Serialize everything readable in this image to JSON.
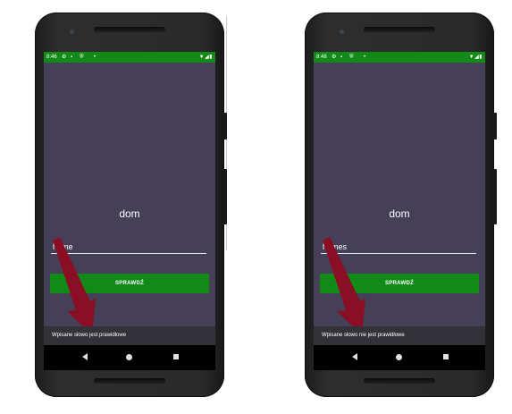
{
  "colors": {
    "screen_bg": "#453f57",
    "accent_green": "#118a17",
    "arrow_red": "#8a0f24",
    "snackbar_bg": "#333238",
    "nav_bar_bg": "#000000"
  },
  "icons": {
    "status": [
      "gear-icon",
      "sim-card-icon",
      "shield-icon",
      "notification-dot-icon",
      "wifi-icon",
      "signal-icon",
      "battery-icon"
    ],
    "nav": [
      "back-icon",
      "home-icon",
      "recents-icon"
    ],
    "annotation": "arrow-icon"
  },
  "left_phone": {
    "status": {
      "time": "8:46"
    },
    "word": "dom",
    "input_value": "home",
    "button_label": "SPRAWDŹ",
    "snackbar_text": "Wpisane słowo jest prawidłowe"
  },
  "right_phone": {
    "status": {
      "time": "8:48"
    },
    "word": "dom",
    "input_value": "homes",
    "button_label": "SPRAWDŹ",
    "snackbar_text": "Wpisane słowo nie jest prawidłowe"
  }
}
